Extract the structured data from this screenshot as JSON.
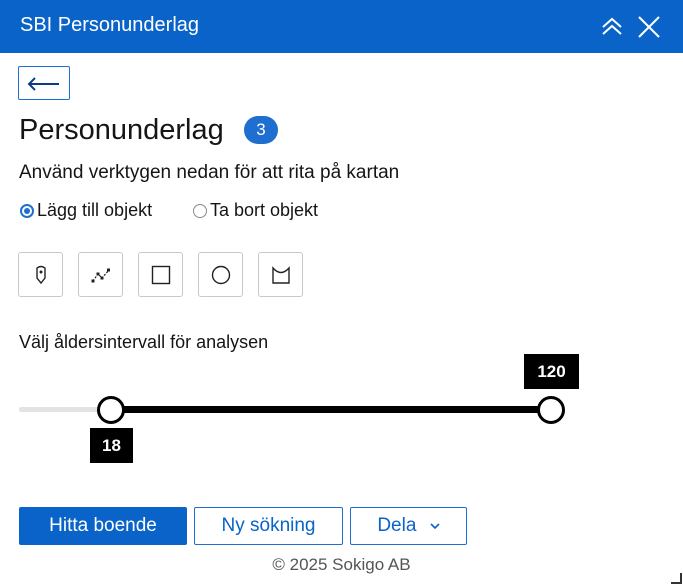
{
  "header": {
    "title": "SBI Personunderlag"
  },
  "page": {
    "title": "Personunderlag",
    "badge_count": "3",
    "instruction": "Använd verktygen nedan för att rita på kartan"
  },
  "mode": {
    "options": [
      "Lägg till objekt",
      "Ta bort objekt"
    ],
    "selected": "Lägg till objekt"
  },
  "tools": [
    "point-tool",
    "polyline-tool",
    "rectangle-tool",
    "circle-tool",
    "freehand-polygon-tool"
  ],
  "age_slider": {
    "label": "Välj åldersintervall för analysen",
    "min_value": "18",
    "max_value": "120"
  },
  "actions": {
    "find_label": "Hitta boende",
    "new_search_label": "Ny sökning",
    "share_label": "Dela"
  },
  "footer": {
    "copyright": "© 2025 Sokigo AB"
  },
  "colors": {
    "brand": "#0a63c8",
    "accent": "#1e6fcf"
  }
}
